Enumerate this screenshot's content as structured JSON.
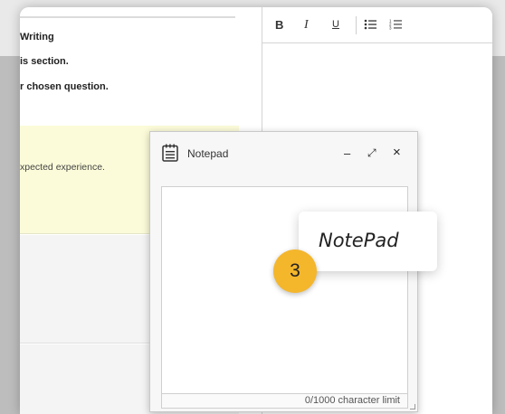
{
  "left_panel": {
    "line1": "Writing",
    "line2": "is section.",
    "line3": "r chosen question.",
    "yellow_text": "xpected experience."
  },
  "toolbar": {
    "bold": "B",
    "italic": "I",
    "underline": "U",
    "bullet_list": "bullet-list-icon",
    "numbered_list": "numbered-list-icon"
  },
  "notepad": {
    "title": "Notepad",
    "minimize": "–",
    "expand": "⤢",
    "close": "×",
    "content": "",
    "limit": "0/1000 character limit"
  },
  "callout": {
    "text": "NotePad",
    "step": "3"
  },
  "colors": {
    "badge": "#f4b62b",
    "highlight": "#fbfbd9"
  }
}
